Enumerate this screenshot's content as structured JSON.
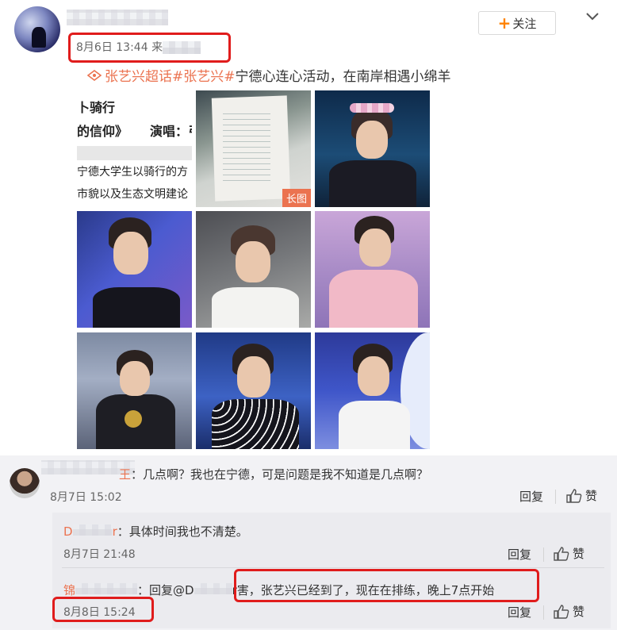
{
  "post": {
    "follow_label": "关注",
    "date": "8月6日 13:44",
    "source_prefix": "来",
    "topic_tag": "张艺兴超话",
    "hashtag": "#张艺兴#",
    "text": " 宁德心连心活动，在南岸相遇小绵羊",
    "image_badge": "长图",
    "doc_lines": [
      "卜骑行",
      "的信仰》",
      "演唱：弓",
      "宁德大学生以骑行的方",
      "市貌以及生态文明建论"
    ]
  },
  "comments": [
    {
      "name_suffix": "王",
      "text": "：几点啊？我也在宁德，可是问题是我不知道是几点啊？",
      "time": "8月7日 15:02",
      "reply_label": "回复",
      "like_label": "赞"
    }
  ],
  "replies": [
    {
      "name_prefix": "D",
      "name_suffix": "r",
      "text": "：具体时间我也不清楚。",
      "time": "8月7日 21:48",
      "reply_label": "回复",
      "like_label": "赞"
    },
    {
      "name_prefix": "锦",
      "reply_to_prefix": "回复@D",
      "reply_to_suffix": "r",
      "text": "害，张艺兴已经到了，现在在排练，晚上7点开始",
      "time": "8月8日 15:24",
      "reply_label": "回复",
      "like_label": "赞"
    }
  ],
  "colors": {
    "accent": "#eb7350",
    "follow_plus": "#ff8200",
    "highlight": "#e01c1c"
  }
}
